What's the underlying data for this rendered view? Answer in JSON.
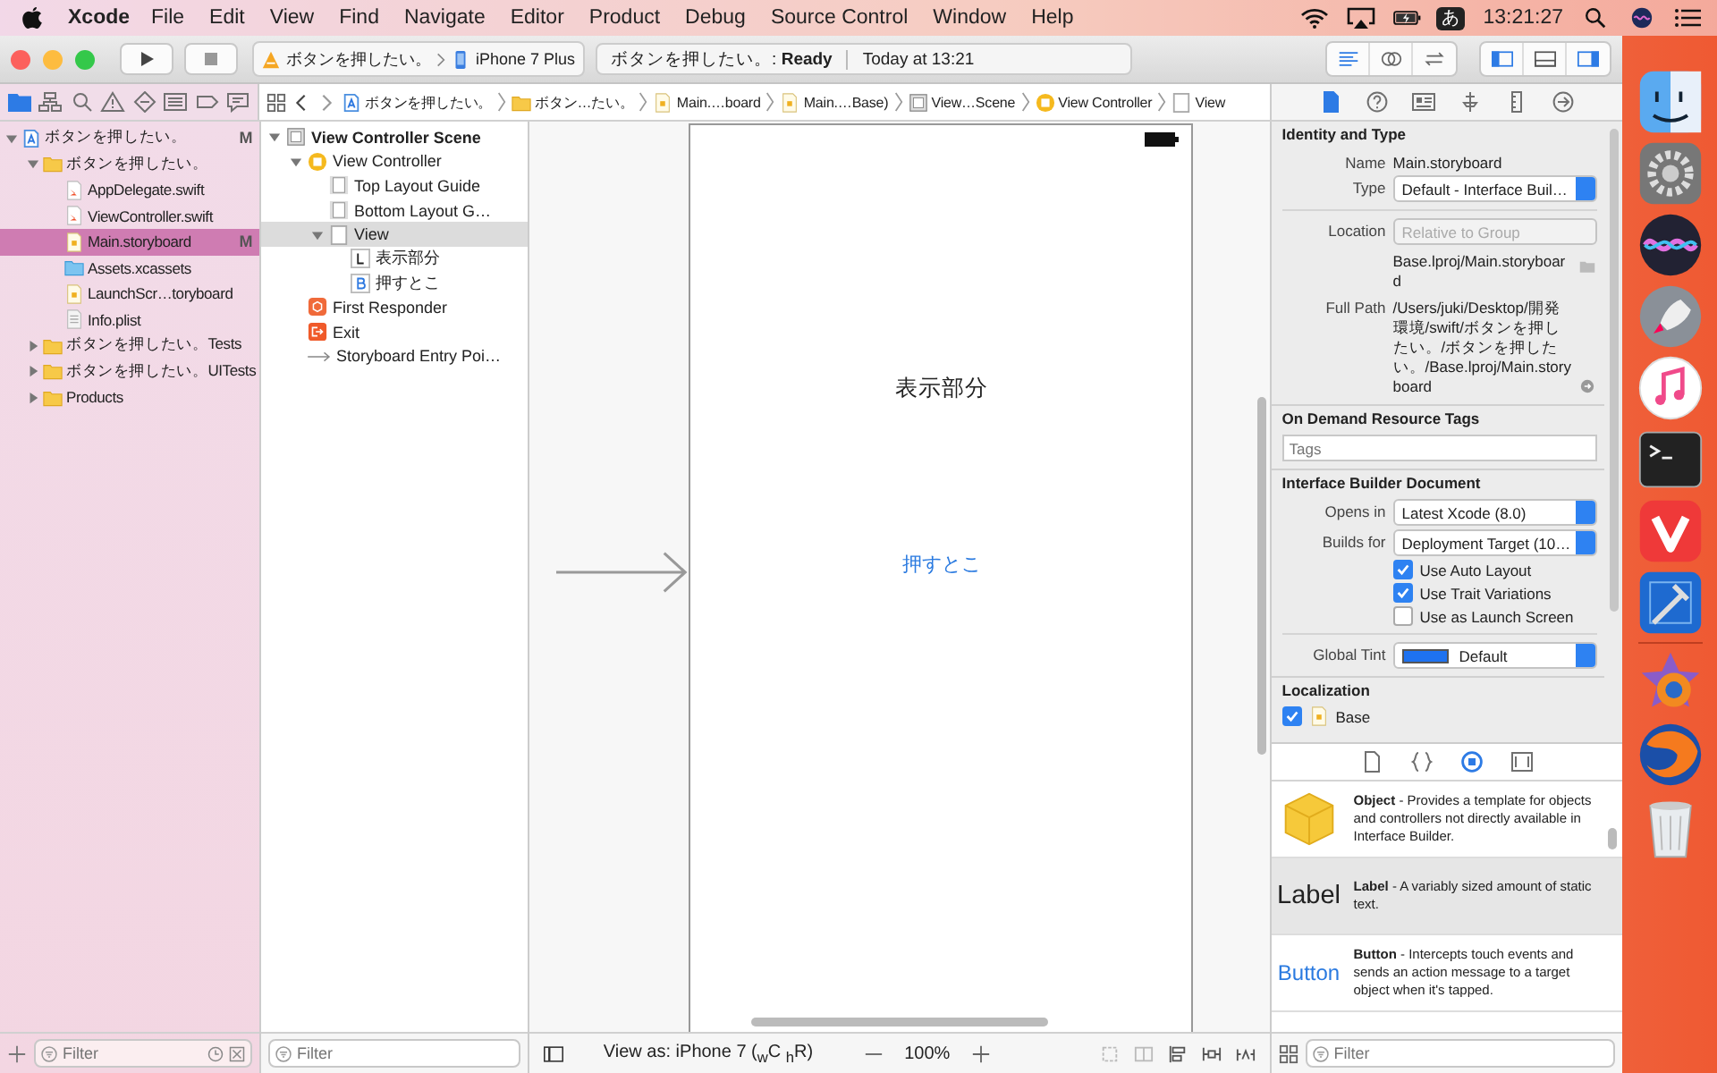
{
  "menu_bar": {
    "app": "Xcode",
    "items": [
      "File",
      "Edit",
      "View",
      "Find",
      "Navigate",
      "Editor",
      "Product",
      "Debug",
      "Source Control",
      "Window",
      "Help"
    ],
    "input_method": "あ",
    "clock": "13:21:27"
  },
  "toolbar": {
    "scheme": "ボタンを押したい。",
    "device": "iPhone 7 Plus",
    "activity": "ボタンを押したい。: **Ready**",
    "activity_time": "Today at 13:21",
    "editor_modes": [
      {
        "kind": "standard",
        "selected": true
      },
      {
        "kind": "assistant",
        "selected": false
      },
      {
        "kind": "version",
        "selected": false
      }
    ],
    "panels": [
      {
        "kind": "navigator",
        "on": true
      },
      {
        "kind": "debug",
        "on": false
      },
      {
        "kind": "utilities",
        "on": true
      }
    ]
  },
  "navigator": {
    "tabs": [
      {
        "kind": "project",
        "selected": true
      },
      {
        "kind": "symbol",
        "selected": false
      },
      {
        "kind": "find",
        "selected": false
      },
      {
        "kind": "issue",
        "selected": false
      },
      {
        "kind": "test",
        "selected": false
      },
      {
        "kind": "debug",
        "selected": false
      },
      {
        "kind": "breakpoint",
        "selected": false
      },
      {
        "kind": "report",
        "selected": false
      }
    ],
    "tree": [
      {
        "label": "ボタンを押したい。",
        "kind": "project",
        "badge": "M",
        "expanded": true,
        "selected": false,
        "children": [
          {
            "label": "ボタンを押したい。",
            "kind": "folder",
            "expanded": true,
            "selected": false,
            "children": [
              {
                "label": "AppDelegate.swift",
                "kind": "swift",
                "selected": false
              },
              {
                "label": "ViewController.swift",
                "kind": "swift",
                "selected": false
              },
              {
                "label": "Main.storyboard",
                "kind": "storyboard",
                "badge": "M",
                "selected": true
              },
              {
                "label": "Assets.xcassets",
                "kind": "assets",
                "selected": false
              },
              {
                "label": "LaunchScr…toryboard",
                "kind": "storyboard",
                "selected": false
              },
              {
                "label": "Info.plist",
                "kind": "plist",
                "selected": false
              }
            ]
          },
          {
            "label": "ボタンを押したい。Tests",
            "kind": "folder",
            "expanded": false,
            "selected": false
          },
          {
            "label": "ボタンを押したい。UITests",
            "kind": "folder",
            "expanded": false,
            "selected": false
          },
          {
            "label": "Products",
            "kind": "folder",
            "expanded": false,
            "selected": false
          }
        ]
      }
    ],
    "filter": {
      "placeholder": "Filter"
    }
  },
  "jump_bar": [
    {
      "label": "ボタンを押したい。",
      "kind": "project"
    },
    {
      "label": "ボタン…たい。",
      "kind": "folder"
    },
    {
      "label": "Main.…board",
      "kind": "storyboard"
    },
    {
      "label": "Main.…Base)",
      "kind": "storyboard"
    },
    {
      "label": "View…Scene",
      "kind": "scene"
    },
    {
      "label": "View Controller",
      "kind": "controller"
    },
    {
      "label": "View",
      "kind": "view"
    }
  ],
  "outline": {
    "tree": [
      {
        "label": "View Controller Scene",
        "kind": "scene",
        "expanded": true,
        "selected": false,
        "children": [
          {
            "label": "View Controller",
            "kind": "controller",
            "expanded": true,
            "selected": false,
            "children": [
              {
                "label": "Top Layout Guide",
                "kind": "guide",
                "selected": false
              },
              {
                "label": "Bottom Layout G…",
                "kind": "guide",
                "selected": false
              },
              {
                "label": "View",
                "kind": "view",
                "expanded": true,
                "selected": true,
                "children": [
                  {
                    "label": "表示部分",
                    "kind": "label",
                    "selected": false
                  },
                  {
                    "label": "押すとこ",
                    "kind": "button",
                    "selected": false
                  }
                ]
              }
            ]
          },
          {
            "label": "First Responder",
            "kind": "responder",
            "selected": false
          },
          {
            "label": "Exit",
            "kind": "exit",
            "selected": false
          },
          {
            "label": "Storyboard Entry Poi…",
            "kind": "entry",
            "selected": false
          }
        ]
      }
    ],
    "filter": {
      "placeholder": "Filter"
    }
  },
  "canvas": {
    "label_text": "表示部分",
    "button_text": "押すとこ",
    "view_as": "View as: iPhone 7 ($_{w}$C $_{h}$R)",
    "zoom": "100%"
  },
  "inspector": {
    "tabs": [
      {
        "kind": "file",
        "selected": true
      },
      {
        "kind": "help",
        "selected": false
      },
      {
        "kind": "identity",
        "selected": false
      },
      {
        "kind": "attributes",
        "selected": false
      },
      {
        "kind": "size",
        "selected": false
      },
      {
        "kind": "connections",
        "selected": false
      }
    ],
    "identity": {
      "title": "Identity and Type",
      "name_label": "Name",
      "name": "Main.storyboard",
      "type_label": "Type",
      "type": "Default - Interface Buil…",
      "location_label": "Location",
      "location": "Relative to Group",
      "relative_path": "Base.lproj/Main.storyboard",
      "full_path_label": "Full Path",
      "full_path": "/Users/juki/Desktop/開発環境/swift/ボタンを押したい。/ボタンを押したい。/Base.lproj/Main.storyboard"
    },
    "tags": {
      "title": "On Demand Resource Tags",
      "placeholder": "Tags"
    },
    "document": {
      "title": "Interface Builder Document",
      "opens_in_label": "Opens in",
      "opens_in": "Latest Xcode (8.0)",
      "builds_for_label": "Builds for",
      "builds_for": "Deployment Target (10…",
      "options": [
        {
          "label": "Use Auto Layout",
          "checked": true
        },
        {
          "label": "Use Trait Variations",
          "checked": true
        },
        {
          "label": "Use as Launch Screen",
          "checked": false
        }
      ],
      "tint_label": "Global Tint",
      "tint": "Default"
    },
    "localization": {
      "title": "Localization",
      "items": [
        {
          "label": "Base",
          "checked": true
        }
      ]
    }
  },
  "library": {
    "tabs": [
      {
        "kind": "file",
        "selected": false
      },
      {
        "kind": "code",
        "selected": false
      },
      {
        "kind": "object",
        "selected": true
      },
      {
        "kind": "media",
        "selected": false
      }
    ],
    "items": [
      {
        "kind": "object",
        "text": "**Object** - Provides a template for objects and controllers not directly available in Interface Builder.",
        "selected": false
      },
      {
        "kind": "label",
        "preview": "Label",
        "text": "**Label** - A variably sized amount of static text.",
        "selected": true
      },
      {
        "kind": "button",
        "preview": "Button",
        "text": "**Button** - Intercepts touch events and sends an action message to a target object when it's tapped.",
        "selected": false
      }
    ],
    "filter": {
      "placeholder": "Filter"
    }
  }
}
